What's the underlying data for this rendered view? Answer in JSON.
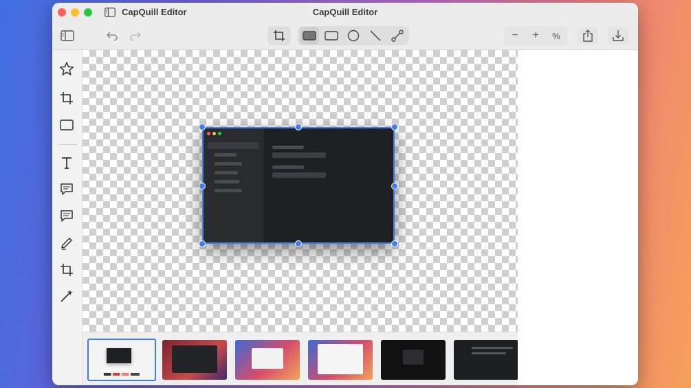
{
  "window": {
    "app_name": "CapQuill Editor",
    "title": "CapQuill Editor"
  },
  "toolbar": {
    "left": [
      "sidebar-toggle-icon",
      "undo-icon",
      "redo-icon"
    ],
    "tools": [
      "crop-icon",
      "rectangle-filled-icon",
      "rectangle-icon",
      "circle-icon",
      "line-icon",
      "connector-icon"
    ],
    "zoom_out_label": "−",
    "zoom_in_label": "+",
    "zoom_percent_label": "%",
    "right": [
      "share-icon",
      "export-icon"
    ]
  },
  "sidebar": {
    "items": [
      "star-icon",
      "crop-icon",
      "rectangle-icon",
      "text-icon",
      "speech-bubble-icon",
      "comment-icon",
      "pen-icon",
      "crop-icon",
      "magic-wand-icon"
    ]
  },
  "canvas": {
    "image": "dark-app-window-screenshot",
    "selection_color": "#3f7ef0"
  },
  "filmstrip": {
    "thumbnails": [
      "current-image",
      "dark-app-window",
      "wallpaper-dialog",
      "wallpaper-settings",
      "dark-dialog",
      "dark-settings"
    ],
    "selected_index": 0
  },
  "colors": {
    "accent": "#3f7ef0",
    "window_bg": "#ececec"
  }
}
